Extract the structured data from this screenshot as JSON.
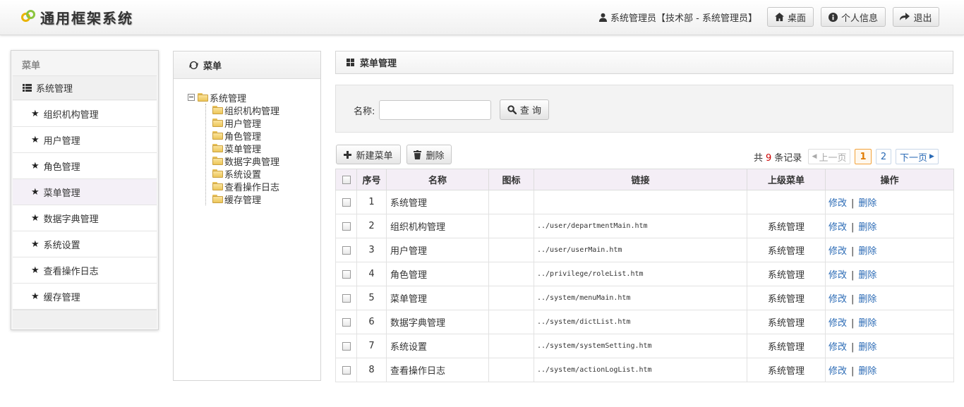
{
  "header": {
    "logo_text": "通用框架系统",
    "user_text": "系统管理员【技术部 - 系统管理员】",
    "buttons": {
      "desktop": "桌面",
      "profile": "个人信息",
      "logout": "退出"
    }
  },
  "sidebar": {
    "title": "菜单",
    "group": "系统管理",
    "items": [
      {
        "label": "组织机构管理"
      },
      {
        "label": "用户管理"
      },
      {
        "label": "角色管理"
      },
      {
        "label": "菜单管理"
      },
      {
        "label": "数据字典管理"
      },
      {
        "label": "系统设置"
      },
      {
        "label": "查看操作日志"
      },
      {
        "label": "缓存管理"
      }
    ]
  },
  "tree_panel": {
    "title": "菜单",
    "root": "系统管理",
    "children": [
      "组织机构管理",
      "用户管理",
      "角色管理",
      "菜单管理",
      "数据字典管理",
      "系统设置",
      "查看操作日志",
      "缓存管理"
    ]
  },
  "main": {
    "title": "菜单管理",
    "search": {
      "label": "名称:",
      "value": "",
      "placeholder": "",
      "button": "查 询"
    },
    "toolbar": {
      "new_label": "新建菜单",
      "delete_label": "删除"
    },
    "records": {
      "prefix": "共",
      "count": "9",
      "suffix": "条记录"
    },
    "pager": {
      "prev": "上一页",
      "pages": [
        "1",
        "2"
      ],
      "next": "下一页"
    },
    "table": {
      "headers": {
        "seq": "序号",
        "name": "名称",
        "icon": "图标",
        "link": "链接",
        "parent": "上级菜单",
        "op": "操作"
      },
      "op_edit": "修改",
      "op_sep": "|",
      "op_delete": "删除",
      "rows": [
        {
          "seq": "1",
          "name": "系统管理",
          "icon": "",
          "link": "",
          "parent": ""
        },
        {
          "seq": "2",
          "name": "组织机构管理",
          "icon": "",
          "link": "../user/departmentMain.htm",
          "parent": "系统管理"
        },
        {
          "seq": "3",
          "name": "用户管理",
          "icon": "",
          "link": "../user/userMain.htm",
          "parent": "系统管理"
        },
        {
          "seq": "4",
          "name": "角色管理",
          "icon": "",
          "link": "../privilege/roleList.htm",
          "parent": "系统管理"
        },
        {
          "seq": "5",
          "name": "菜单管理",
          "icon": "",
          "link": "../system/menuMain.htm",
          "parent": "系统管理"
        },
        {
          "seq": "6",
          "name": "数据字典管理",
          "icon": "",
          "link": "../system/dictList.htm",
          "parent": "系统管理"
        },
        {
          "seq": "7",
          "name": "系统设置",
          "icon": "",
          "link": "../system/systemSetting.htm",
          "parent": "系统管理"
        },
        {
          "seq": "8",
          "name": "查看操作日志",
          "icon": "",
          "link": "../system/actionLogList.htm",
          "parent": "系统管理"
        }
      ]
    }
  }
}
